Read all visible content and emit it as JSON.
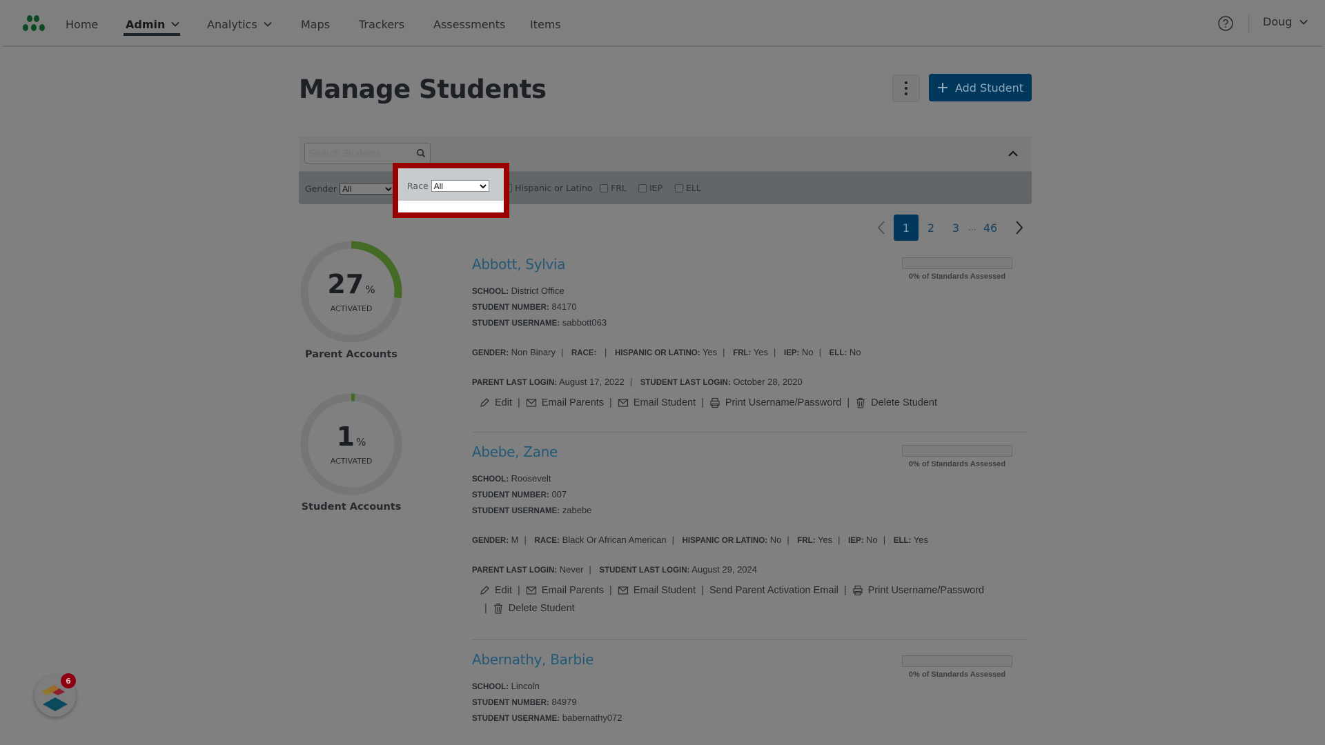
{
  "nav": {
    "items": [
      {
        "label": "Home",
        "has_dropdown": false
      },
      {
        "label": "Admin",
        "has_dropdown": true,
        "active": true
      },
      {
        "label": "Analytics",
        "has_dropdown": true
      },
      {
        "label": "Maps",
        "has_dropdown": false
      },
      {
        "label": "Trackers",
        "has_dropdown": false
      },
      {
        "label": "Assessments",
        "has_dropdown": false
      },
      {
        "label": "Items",
        "has_dropdown": false
      }
    ],
    "help_icon": "question-circle-icon",
    "user_label": "Doug"
  },
  "page": {
    "title": "Manage Students",
    "add_button_label": "Add Student",
    "more_icon": "kebab-menu-icon"
  },
  "filters": {
    "search_placeholder": "Search Students",
    "gender_label": "Gender",
    "gender_value": "All",
    "race_label": "Race",
    "race_value": "All",
    "checkboxes": [
      {
        "label": "Hispanic or Latino",
        "checked": false
      },
      {
        "label": "FRL",
        "checked": false
      },
      {
        "label": "IEP",
        "checked": false
      },
      {
        "label": "ELL",
        "checked": false
      }
    ]
  },
  "highlight_color": "#990000",
  "pagination": {
    "pages": [
      "1",
      "2",
      "3"
    ],
    "ellipsis": "...",
    "last": "46",
    "current": "1"
  },
  "stats": {
    "parent": {
      "value": "27",
      "percent_sign": "%",
      "sub": "ACTIVATED",
      "label": "Parent Accounts",
      "fraction": 0.27
    },
    "student": {
      "value": "1",
      "percent_sign": "%",
      "sub": "ACTIVATED",
      "label": "Student Accounts",
      "fraction": 0.01
    },
    "accent_color": "#436b25"
  },
  "labels": {
    "school": "SCHOOL:",
    "student_number": "STUDENT NUMBER:",
    "student_username": "STUDENT USERNAME:",
    "gender": "GENDER:",
    "race": "RACE:",
    "hispanic": "HISPANIC OR LATINO:",
    "frl": "FRL:",
    "iep": "IEP:",
    "ell": "ELL:",
    "parent_last_login": "PARENT LAST LOGIN:",
    "student_last_login": "STUDENT LAST LOGIN:",
    "standards_assessed": "0% of Standards Assessed",
    "edit": "Edit",
    "email_parents": "Email Parents",
    "email_student": "Email Student",
    "send_activation": "Send Parent Activation Email",
    "print": "Print Username/Password",
    "delete": "Delete Student"
  },
  "students": [
    {
      "name": "Abbott, Sylvia",
      "school": "District Office",
      "number": "84170",
      "username": "sabbott063",
      "gender": "Non Binary",
      "race": "",
      "hispanic": "Yes",
      "frl": "Yes",
      "iep": "No",
      "ell": "No",
      "parent_last_login": "August 17, 2022",
      "student_last_login": "October 28, 2020",
      "standards_fraction": 0
    },
    {
      "name": "Abebe, Zane",
      "school": "Roosevelt",
      "number": "007",
      "username": "zabebe",
      "gender": "M",
      "race": "Black Or African American",
      "hispanic": "No",
      "frl": "Yes",
      "iep": "No",
      "ell": "Yes",
      "parent_last_login": "Never",
      "student_last_login": "August 29, 2024",
      "standards_fraction": 0
    },
    {
      "name": "Abernathy, Barbie",
      "school": "Lincoln",
      "number": "84979",
      "username": "babernathy072",
      "standards_fraction": 0
    }
  ],
  "widget": {
    "badge_count": "6"
  }
}
